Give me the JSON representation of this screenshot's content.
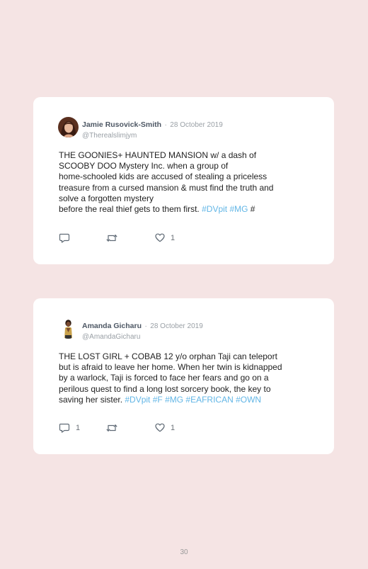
{
  "tweets": [
    {
      "name": "Jamie Rusovick-Smith",
      "separator": "·",
      "date": "28 October 2019",
      "handle": "@Therealslimjym",
      "text": "THE GOONIES+ HAUNTED MANSION w/ a dash of\nSCOOBY DOO Mystery Inc. when a group of\nhome-schooled kids are accused of stealing a priceless\ntreasure from a cursed mansion & must find the truth and\nsolve a forgotten mystery\nbefore the real thief gets to them first. ",
      "tags": "#DVpit #MG",
      "trailing": " #",
      "reply_count": "",
      "like_count": "1"
    },
    {
      "name": "Amanda Gicharu",
      "separator": "·",
      "date": "28 October 2019",
      "handle": "@AmandaGicharu",
      "text": "THE LOST GIRL + COBAB 12 y/o orphan Taji can teleport\nbut is afraid to leave her home. When her twin is kidnapped\nby a warlock, Taji is forced to face her fears and go on a\nperilous quest to find a long lost sorcery book, the key to\nsaving her sister. ",
      "tags": "#DVpit #F #MG #EAFRICAN #OWN",
      "trailing": "",
      "reply_count": "1",
      "like_count": "1"
    }
  ],
  "page_number": "30",
  "colors": {
    "background": "#f5e4e4",
    "hashtag": "#62b6e6",
    "name": "#4d5764",
    "muted": "#9aa0a6"
  },
  "icons": {
    "reply": "reply-icon",
    "retweet": "retweet-icon",
    "like": "heart-icon"
  }
}
